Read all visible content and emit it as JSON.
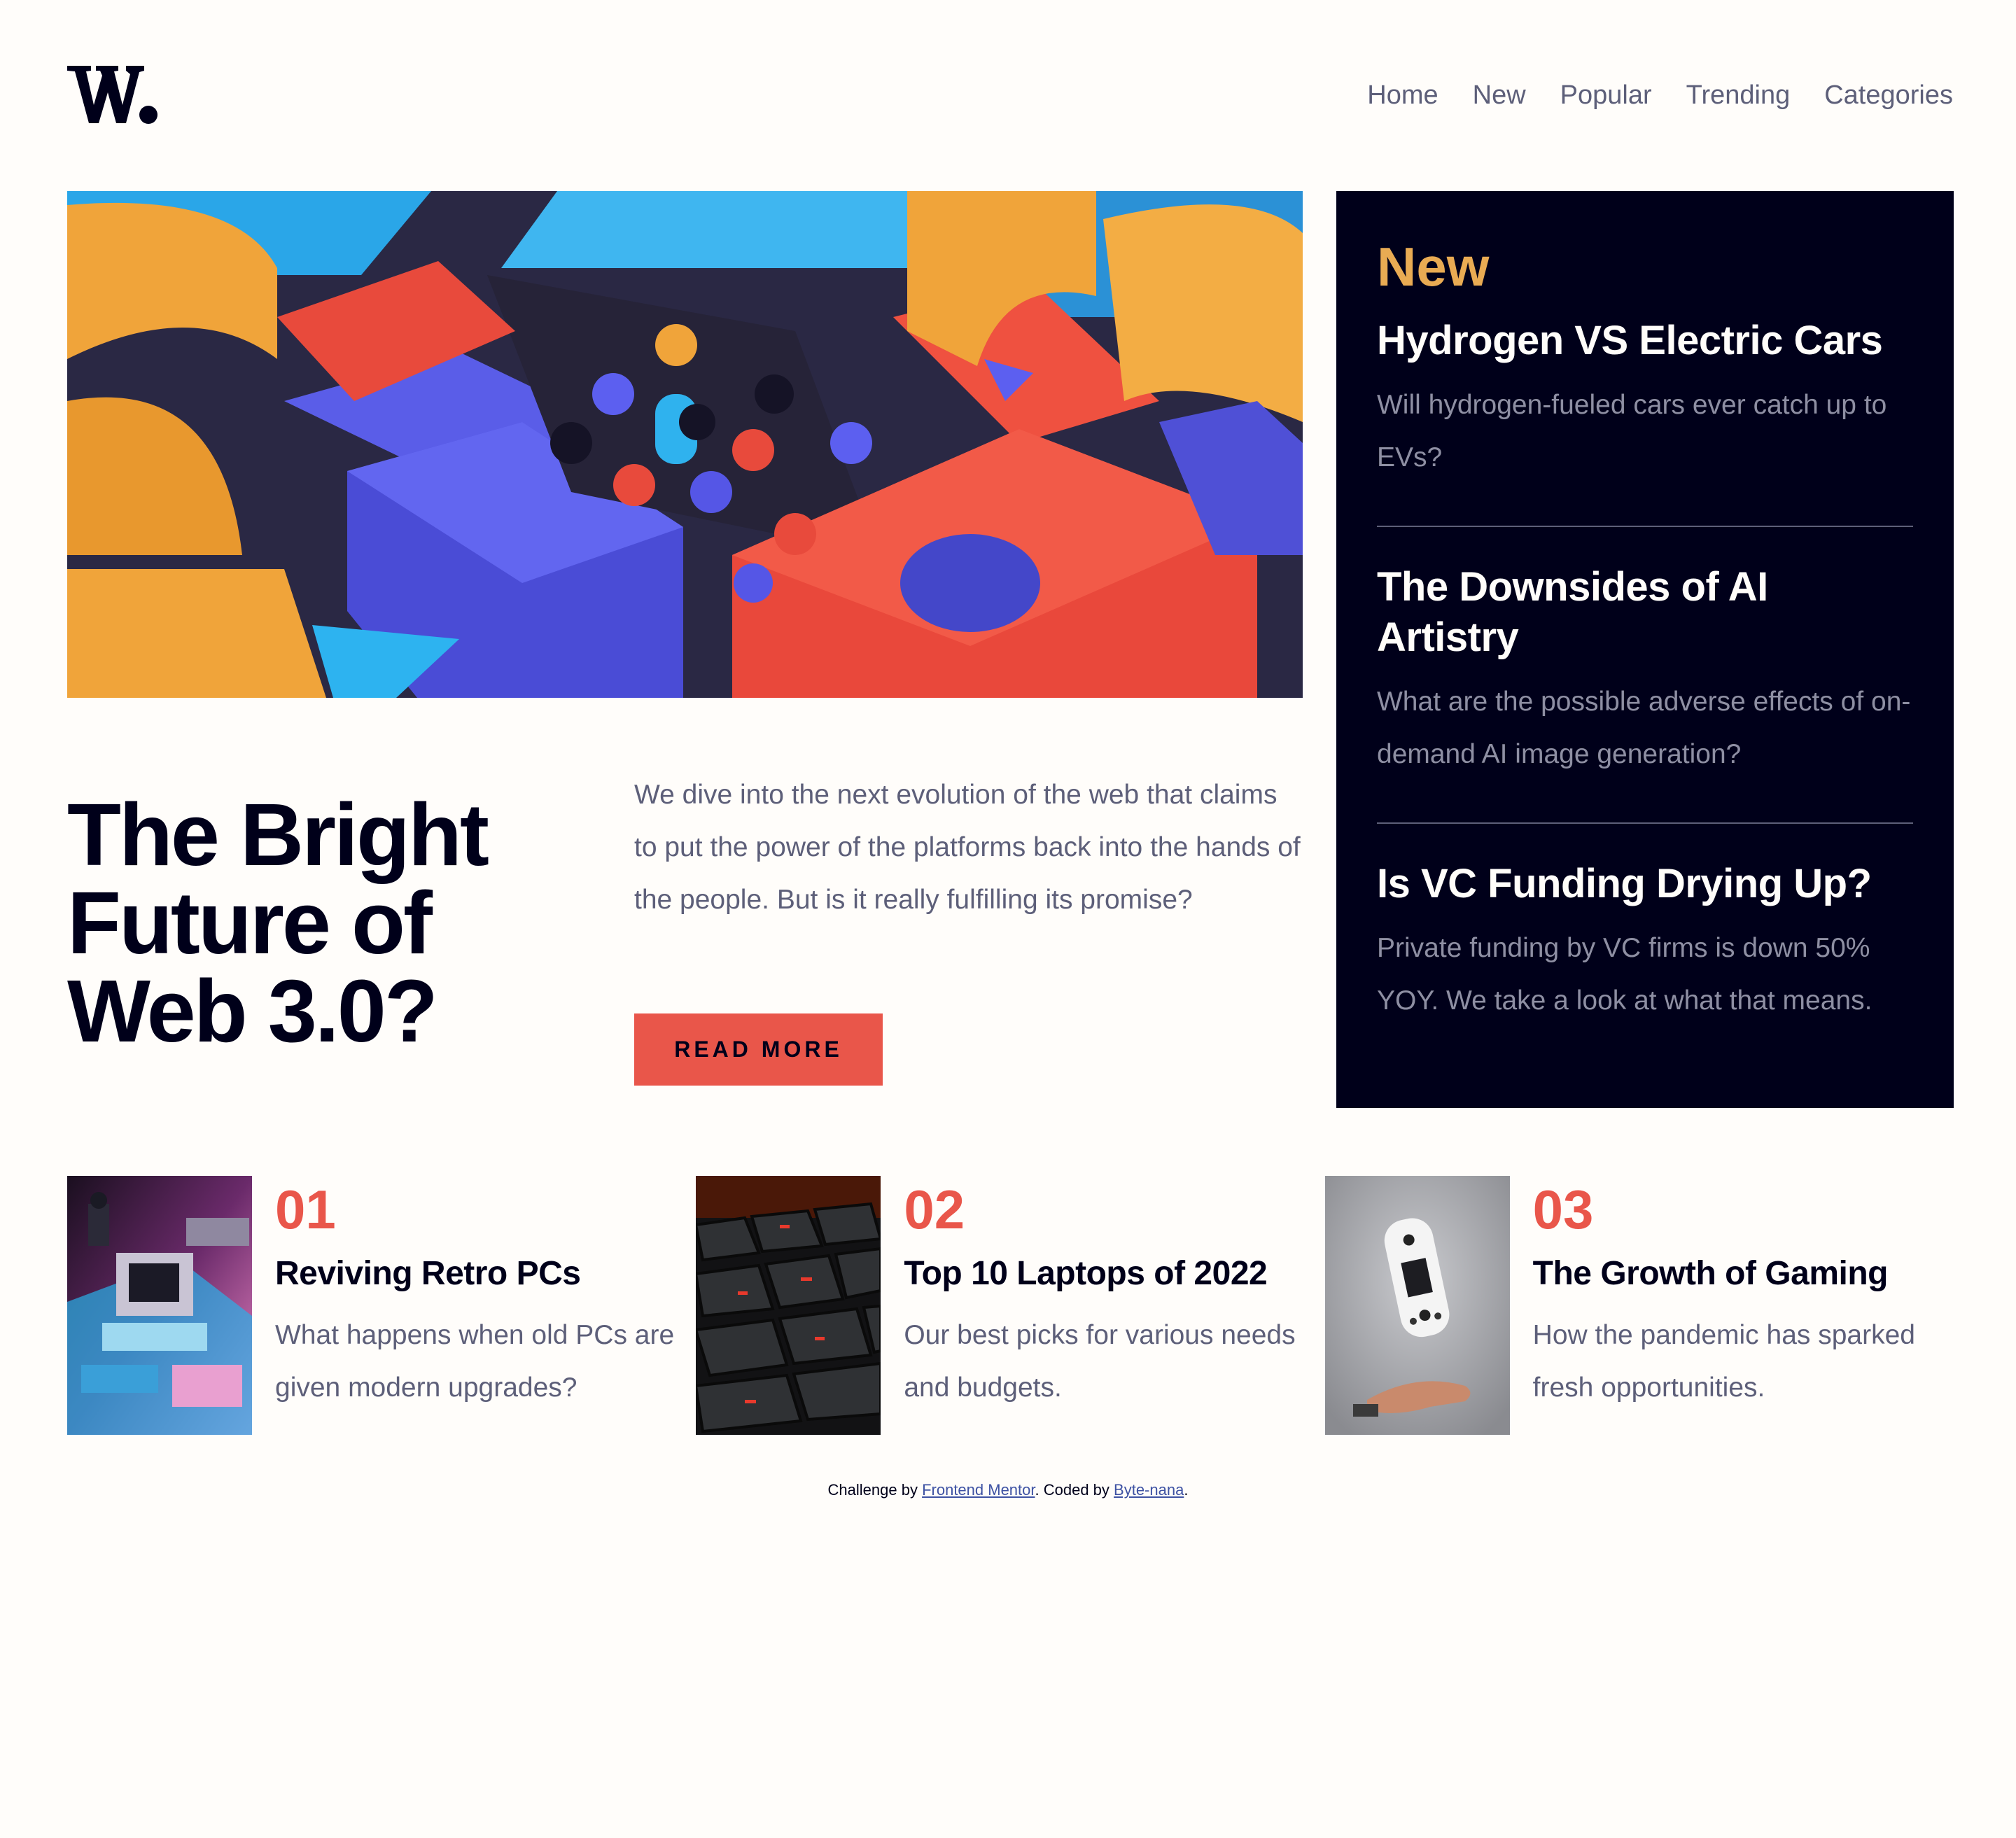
{
  "logo": {
    "icon": "w-logo-icon"
  },
  "nav": {
    "items": [
      "Home",
      "New",
      "Popular",
      "Trending",
      "Categories"
    ]
  },
  "hero": {
    "title": "The Bright Future of Web 3.0?",
    "description": "We dive into the next evolution of the web that claims to put the power of the platforms back into the hands of the people. But is it really fulfilling its promise?",
    "button_label": "READ MORE"
  },
  "new_panel": {
    "heading": "New",
    "items": [
      {
        "title": "Hydrogen VS Electric Cars",
        "text": "Will hydrogen-fueled cars ever catch up to EVs?"
      },
      {
        "title": "The Downsides of AI Artistry",
        "text": "What are the possible adverse effects of on-demand AI image generation?"
      },
      {
        "title": "Is VC Funding Drying Up?",
        "text": "Private funding by VC firms is down 50% YOY. We take a look at what that means."
      }
    ]
  },
  "cards": [
    {
      "number": "01",
      "title": "Reviving Retro PCs",
      "text": "What happens when old PCs are given modern upgrades?"
    },
    {
      "number": "02",
      "title": "Top 10 Laptops of 2022",
      "text": "Our best picks for various needs and budgets."
    },
    {
      "number": "03",
      "title": "The Growth of Gaming",
      "text": "How the pandemic has sparked fresh opportunities."
    }
  ],
  "attribution": {
    "prefix": "Challenge by ",
    "link1": "Frontend Mentor",
    "middle": ". Coded by ",
    "link2": "Byte-nana",
    "suffix": "."
  },
  "colors": {
    "accent_red": "#e9564a",
    "accent_orange": "#e9ab53",
    "dark_navy": "#00001a",
    "grayish_blue": "#5d5f79",
    "off_white": "#fffdfa"
  }
}
